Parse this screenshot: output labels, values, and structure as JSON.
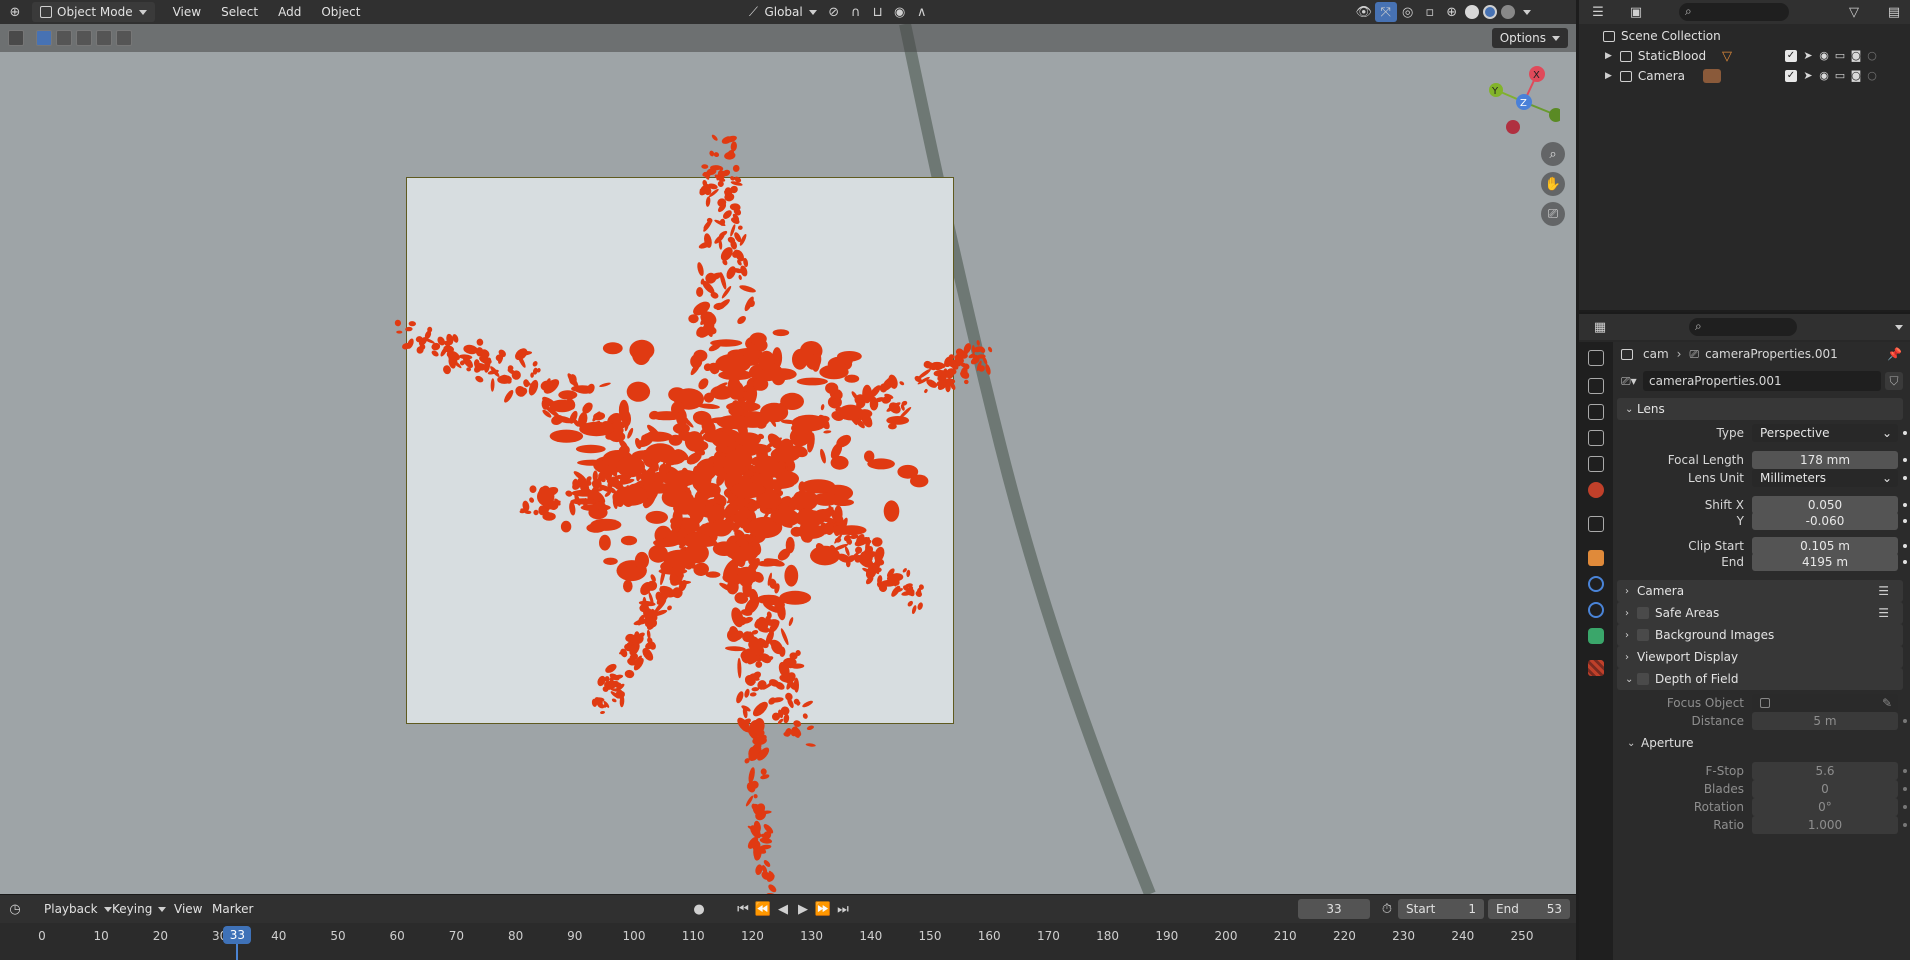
{
  "header": {
    "mode": "Object Mode",
    "menus": [
      "View",
      "Select",
      "Add",
      "Object"
    ],
    "orientation": "Global"
  },
  "viewport": {
    "options_label": "Options",
    "blood_color": "#e03a12"
  },
  "timeline": {
    "menus": [
      "Playback",
      "Keying",
      "View",
      "Marker"
    ],
    "current_frame": "33",
    "start_label": "Start",
    "start_value": "1",
    "end_label": "End",
    "end_value": "53",
    "ticks": [
      "0",
      "10",
      "20",
      "30",
      "40",
      "50",
      "60",
      "70",
      "80",
      "90",
      "100",
      "110",
      "120",
      "130",
      "140",
      "150",
      "160",
      "170",
      "180",
      "190",
      "200",
      "210",
      "220",
      "230",
      "240",
      "250"
    ]
  },
  "outliner": {
    "root": "Scene Collection",
    "items": [
      {
        "label": "StaticBlood"
      },
      {
        "label": "Camera"
      }
    ]
  },
  "properties": {
    "breadcrumb_object": "cam",
    "breadcrumb_data": "cameraProperties.001",
    "datablock_name": "cameraProperties.001",
    "lens": {
      "title": "Lens",
      "type_label": "Type",
      "type_value": "Perspective",
      "focal_label": "Focal Length",
      "focal_value": "178 mm",
      "unit_label": "Lens Unit",
      "unit_value": "Millimeters",
      "shiftx_label": "Shift X",
      "shiftx_value": "0.050",
      "shifty_label": "Y",
      "shifty_value": "-0.060",
      "clipstart_label": "Clip Start",
      "clipstart_value": "0.105 m",
      "clipend_label": "End",
      "clipend_value": "4195 m"
    },
    "panels": {
      "camera": "Camera",
      "safe_areas": "Safe Areas",
      "background_images": "Background Images",
      "viewport_display": "Viewport Display",
      "dof": "Depth of Field"
    },
    "dof": {
      "focus_label": "Focus Object",
      "distance_label": "Distance",
      "distance_value": "5 m",
      "aperture_title": "Aperture",
      "fstop_label": "F-Stop",
      "fstop_value": "5.6",
      "blades_label": "Blades",
      "blades_value": "0",
      "rotation_label": "Rotation",
      "rotation_value": "0°",
      "ratio_label": "Ratio",
      "ratio_value": "1.000"
    }
  }
}
